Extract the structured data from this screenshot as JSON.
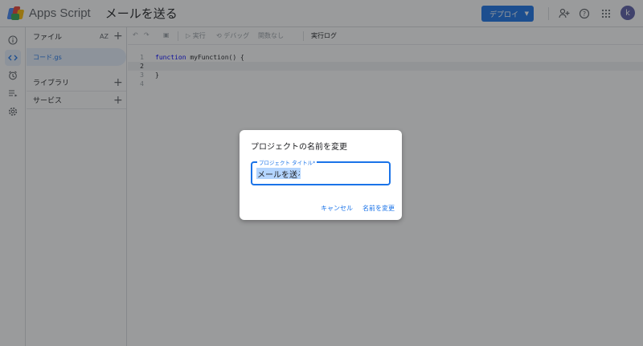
{
  "app": {
    "name": "Apps Script",
    "project_title": "メールを送る"
  },
  "topbar": {
    "deploy_label": "デプロイ",
    "avatar_letter": "k",
    "icons": [
      "add-person-icon",
      "help-icon",
      "apps-grid-icon"
    ]
  },
  "rail": {
    "icons": [
      "info-icon",
      "code-icon",
      "alarm-icon",
      "executions-icon",
      "settings-icon"
    ],
    "active": "code-icon"
  },
  "files_panel": {
    "header": "ファイル",
    "sort_label": "AZ",
    "file": "コード.gs",
    "sections": [
      "ライブラリ",
      "サービス"
    ]
  },
  "editor_toolbar": {
    "run": "実行",
    "debug": "デバッグ",
    "function_select": "関数なし",
    "exec_log": "実行ログ"
  },
  "code": {
    "lines": [
      {
        "num": "1",
        "keyword": "function",
        "rest": " myFunction() {"
      },
      {
        "num": "2",
        "keyword": "",
        "rest": ""
      },
      {
        "num": "3",
        "keyword": "",
        "rest": "}"
      },
      {
        "num": "4",
        "keyword": "",
        "rest": ""
      }
    ]
  },
  "dialog": {
    "title": "プロジェクトの名前を変更",
    "field_label": "プロジェクト タイトル*",
    "field_value": "メールを送る",
    "cancel": "キャンセル",
    "confirm": "名前を変更"
  },
  "colors": {
    "accent": "#1a73e8",
    "overlay": "rgba(32,33,36,0.45)",
    "selection": "#b4d5fe"
  }
}
